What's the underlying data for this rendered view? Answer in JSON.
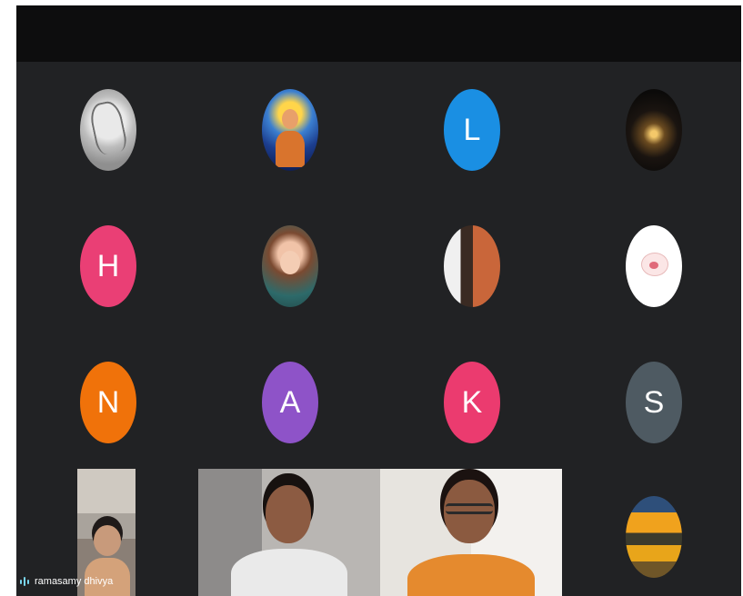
{
  "participants": [
    {
      "id": "p1",
      "initial": "",
      "color": "#bdbdbd",
      "picture": "sketch-girl"
    },
    {
      "id": "p2",
      "initial": "",
      "color": "#1c3e8f",
      "picture": "deity-illustration"
    },
    {
      "id": "p3",
      "initial": "L",
      "color": "#1a8fe3",
      "picture": ""
    },
    {
      "id": "p4",
      "initial": "",
      "color": "#0b0a09",
      "picture": "sparkler"
    },
    {
      "id": "p5",
      "initial": "H",
      "color": "#ea3f75",
      "picture": ""
    },
    {
      "id": "p6",
      "initial": "",
      "color": "#2d6a6a",
      "picture": "cartoon-girl"
    },
    {
      "id": "p7",
      "initial": "",
      "color": "#c9663a",
      "picture": "photo"
    },
    {
      "id": "p8",
      "initial": "",
      "color": "#ffffff",
      "picture": "bear-sticker"
    },
    {
      "id": "p9",
      "initial": "N",
      "color": "#f0720a",
      "picture": ""
    },
    {
      "id": "p10",
      "initial": "A",
      "color": "#8e53c8",
      "picture": ""
    },
    {
      "id": "p11",
      "initial": "K",
      "color": "#eb3b6f",
      "picture": ""
    },
    {
      "id": "p12",
      "initial": "S",
      "color": "#4e5a62",
      "picture": ""
    },
    {
      "id": "p13",
      "initial": "",
      "color": "#f0a21d",
      "picture": "sunset"
    }
  ],
  "videos": [
    {
      "id": "v1",
      "name": "ramasamy dhivya"
    },
    {
      "id": "v2",
      "name": ""
    },
    {
      "id": "v3",
      "name": ""
    }
  ],
  "speaking_indicator_color": "#7ad6f0"
}
